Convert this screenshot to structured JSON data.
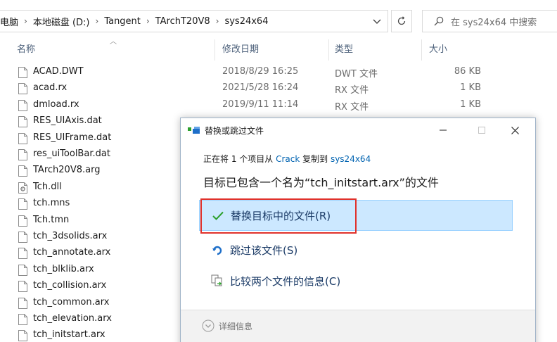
{
  "address_bar": {
    "crumbs": [
      "电脑",
      "本地磁盘 (D:)",
      "Tangent",
      "TArchT20V8",
      "sys24x64"
    ],
    "separator": "›"
  },
  "search": {
    "placeholder": "在 sys24x64 中搜索"
  },
  "columns": {
    "name": "名称",
    "date": "修改日期",
    "type": "类型",
    "size": "大小"
  },
  "files": [
    {
      "name": "ACAD.DWT",
      "date": "2018/8/29 16:25",
      "type": "DWT 文件",
      "size": "86 KB",
      "icon": "file-icon"
    },
    {
      "name": "acad.rx",
      "date": "2021/5/28 16:24",
      "type": "RX 文件",
      "size": "1 KB",
      "icon": "file-icon"
    },
    {
      "name": "dmload.rx",
      "date": "2019/9/11 11:14",
      "type": "RX 文件",
      "size": "1 KB",
      "icon": "file-icon"
    },
    {
      "name": "RES_UIAxis.dat",
      "icon": "file-icon"
    },
    {
      "name": "RES_UIFrame.dat",
      "icon": "file-icon"
    },
    {
      "name": "res_uiToolBar.dat",
      "icon": "file-icon"
    },
    {
      "name": "TArch20V8.arg",
      "icon": "file-icon"
    },
    {
      "name": "Tch.dll",
      "icon": "dll-gear-icon"
    },
    {
      "name": "tch.mns",
      "icon": "file-icon"
    },
    {
      "name": "Tch.tmn",
      "icon": "file-icon"
    },
    {
      "name": "tch_3dsolids.arx",
      "icon": "file-icon"
    },
    {
      "name": "tch_annotate.arx",
      "icon": "file-icon"
    },
    {
      "name": "tch_blklib.arx",
      "icon": "file-icon"
    },
    {
      "name": "tch_collision.arx",
      "icon": "file-icon"
    },
    {
      "name": "tch_common.arx",
      "icon": "file-icon"
    },
    {
      "name": "tch_elevation.arx",
      "icon": "file-icon"
    },
    {
      "name": "tch_initstart.arx",
      "icon": "file-icon"
    }
  ],
  "dialog": {
    "title": "替换或跳过文件",
    "sub_prefix": "正在将 1 个项目从 ",
    "sub_source": "Crack",
    "sub_middle": " 复制到 ",
    "sub_dest": "sys24x64",
    "heading": "目标已包含一个名为“tch_initstart.arx”的文件",
    "options": {
      "replace": "替换目标中的文件(R)",
      "skip": "跳过该文件(S)",
      "compare": "比较两个文件的信息(C)"
    },
    "details_label": "详细信息"
  },
  "colors": {
    "accent_blue": "#0063b1",
    "selected_bg": "#cce8ff",
    "highlight_red": "#e0312b",
    "check_green": "#2ca02c"
  }
}
